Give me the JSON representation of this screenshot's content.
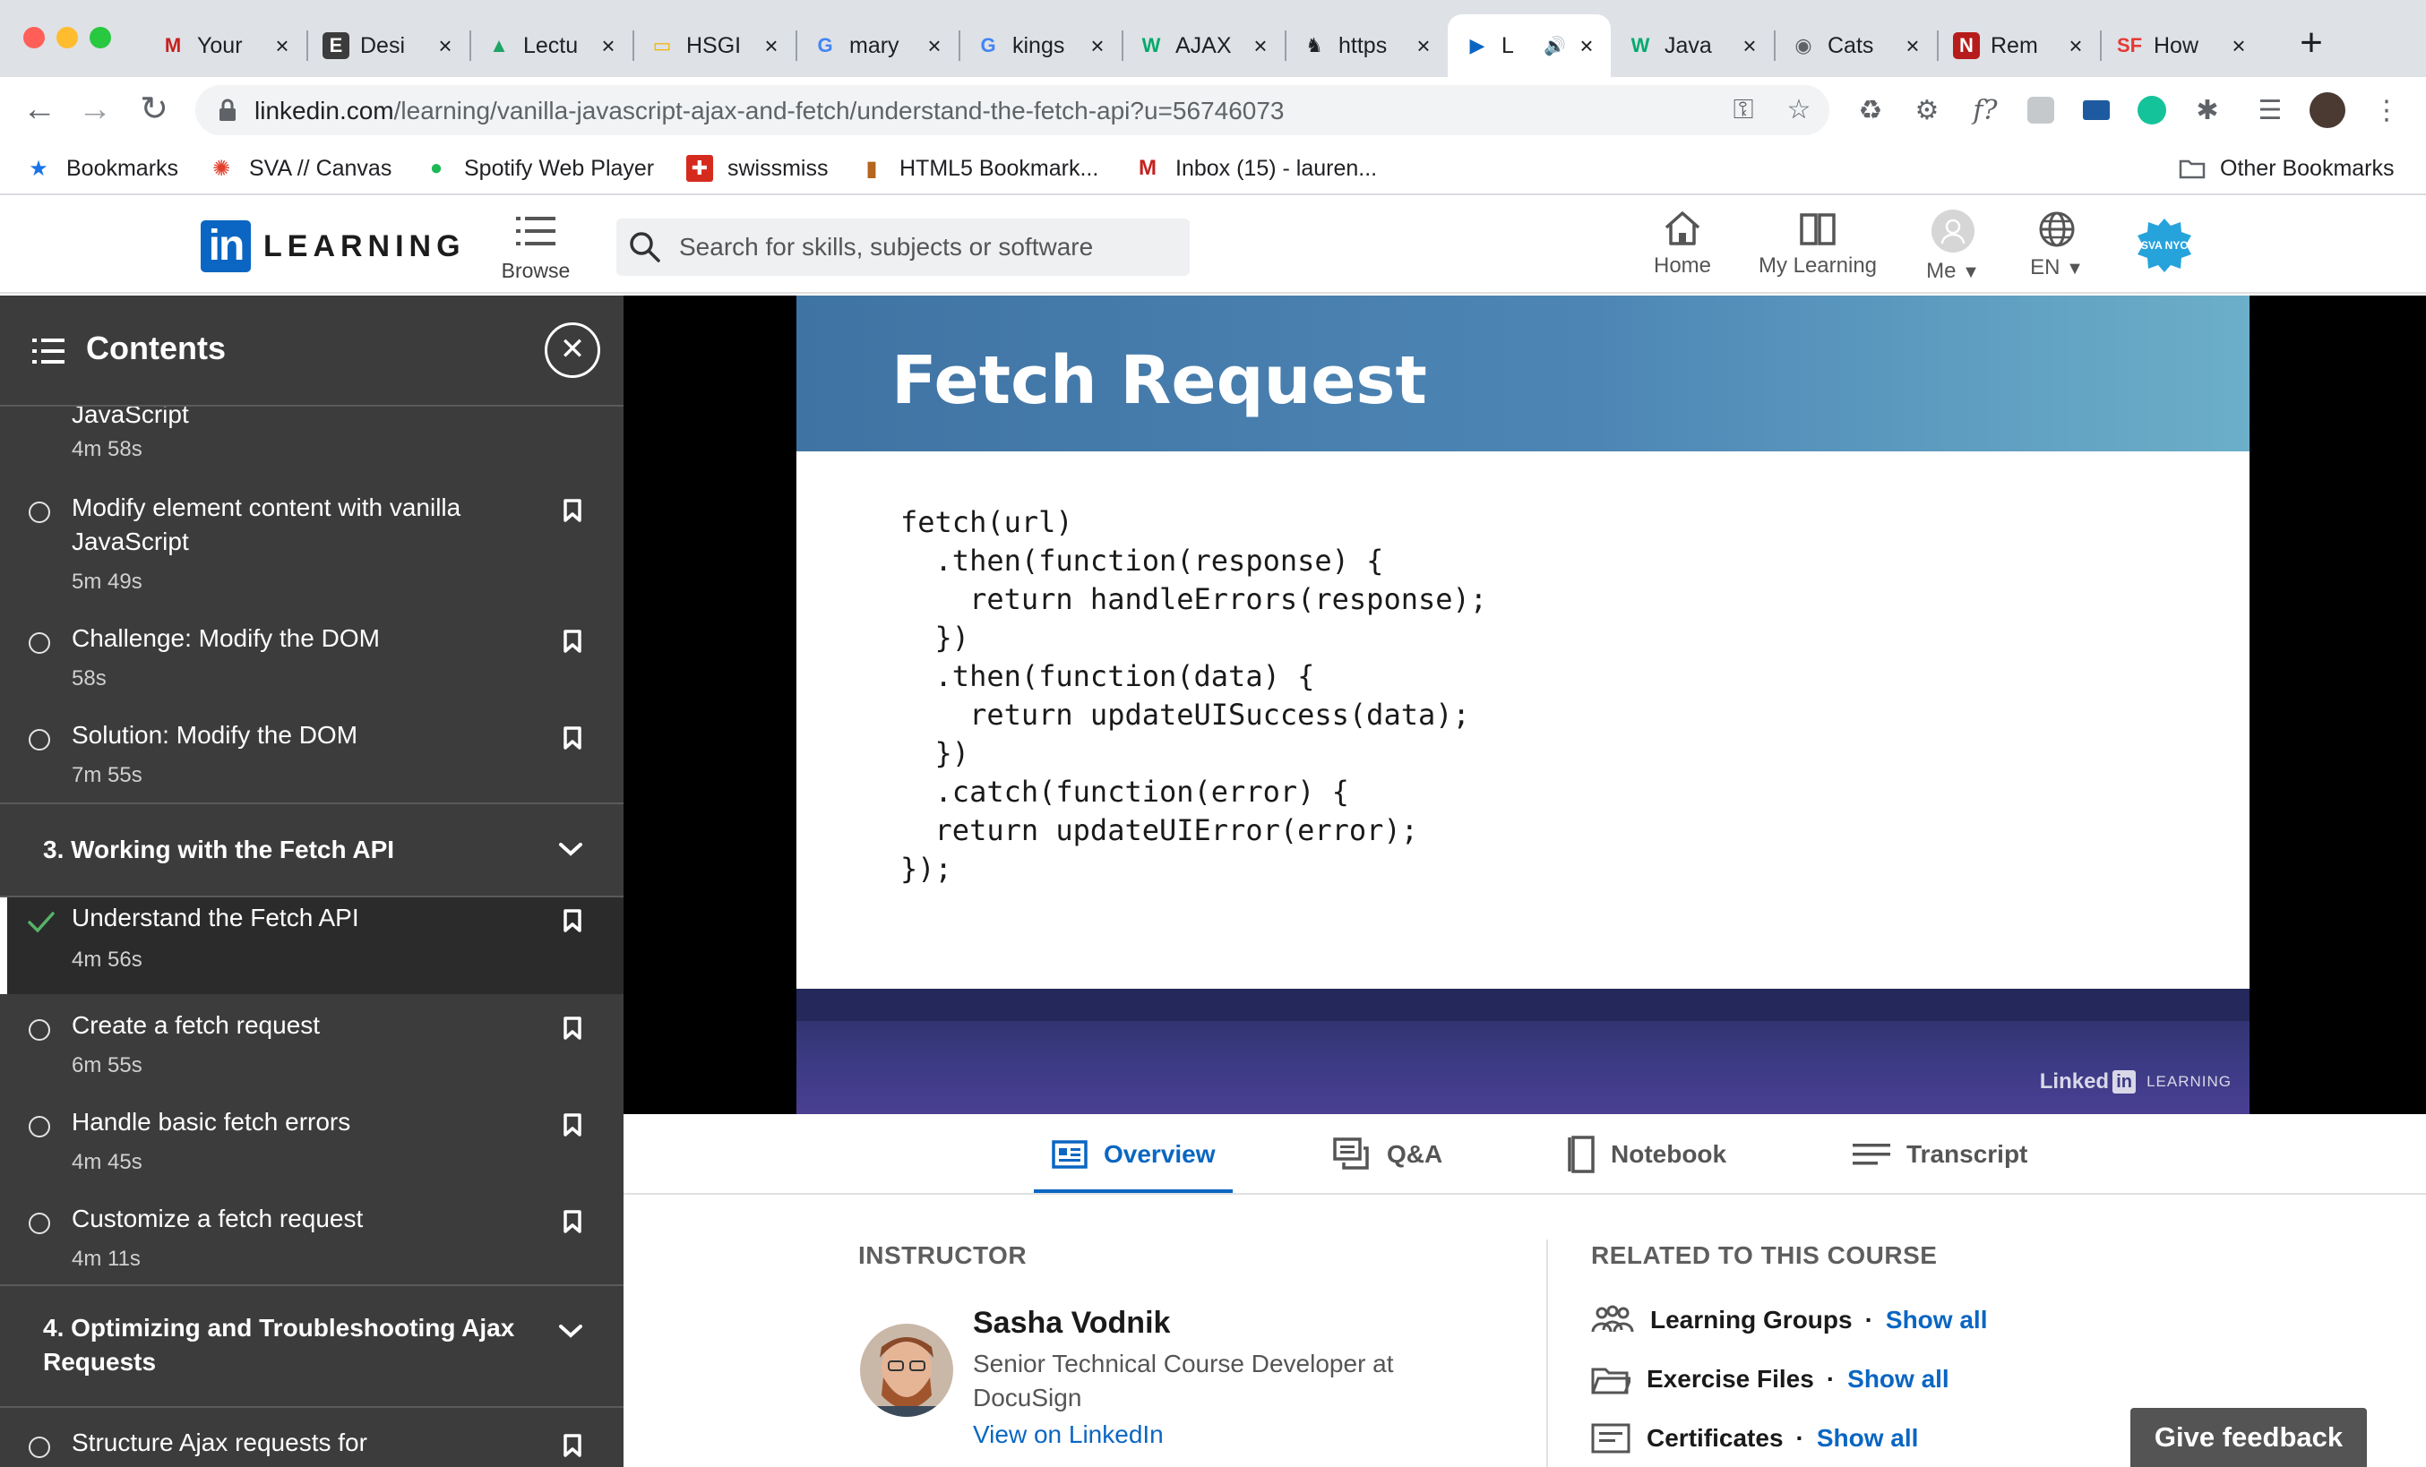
{
  "browser": {
    "tabs": [
      {
        "title": "Your",
        "favicon": "gmail-icon",
        "fav_text": "M",
        "fav_color": "#c5221f",
        "fav_bg": "transparent"
      },
      {
        "title": "Desi",
        "favicon": "e-icon",
        "fav_text": "E",
        "fav_color": "#ffffff",
        "fav_bg": "#3c3c3c"
      },
      {
        "title": "Lectu",
        "favicon": "google-drive-icon",
        "fav_text": "▲",
        "fav_color": "#1fa463",
        "fav_bg": "transparent"
      },
      {
        "title": "HSGI",
        "favicon": "google-slides-icon",
        "fav_text": "▭",
        "fav_color": "#f4b400",
        "fav_bg": "transparent"
      },
      {
        "title": "mary",
        "favicon": "google-icon",
        "fav_text": "G",
        "fav_color": "#4285f4",
        "fav_bg": "transparent"
      },
      {
        "title": "kings",
        "favicon": "google-icon",
        "fav_text": "G",
        "fav_color": "#4285f4",
        "fav_bg": "transparent"
      },
      {
        "title": "AJAX",
        "favicon": "w3schools-icon",
        "fav_text": "W",
        "fav_color": "#04aa6d",
        "fav_bg": "transparent"
      },
      {
        "title": "https",
        "favicon": "unicorn-icon",
        "fav_text": "♞",
        "fav_color": "#202124",
        "fav_bg": "transparent"
      },
      {
        "title": "L",
        "favicon": "linkedin-learning-icon",
        "fav_text": "▶",
        "fav_color": "#0a66c2",
        "fav_bg": "transparent",
        "active": true
      },
      {
        "title": "Java",
        "favicon": "w3schools-icon",
        "fav_text": "W",
        "fav_color": "#04aa6d",
        "fav_bg": "transparent"
      },
      {
        "title": "Cats",
        "favicon": "globe-icon",
        "fav_text": "◉",
        "fav_color": "#5f6368",
        "fav_bg": "transparent"
      },
      {
        "title": "Rem",
        "favicon": "ne-icon",
        "fav_text": "N",
        "fav_color": "#ffffff",
        "fav_bg": "#b71c1c"
      },
      {
        "title": "How",
        "favicon": "sf-icon",
        "fav_text": "SF",
        "fav_color": "#e53935",
        "fav_bg": "transparent"
      }
    ],
    "url_host": "linkedin.com",
    "url_path": "/learning/vanilla-javascript-ajax-and-fetch/understand-the-fetch-api?u=56746073",
    "bookmarks": [
      {
        "label": "Bookmarks",
        "icon": "star-icon",
        "glyph": "★",
        "color": "#1a73e8"
      },
      {
        "label": "SVA // Canvas",
        "icon": "canvas-icon",
        "glyph": "✺",
        "color": "#e13f2b"
      },
      {
        "label": "Spotify Web Player",
        "icon": "spotify-icon",
        "glyph": "●",
        "color": "#1db954"
      },
      {
        "label": "swissmiss",
        "icon": "swiss-icon",
        "glyph": "✚",
        "color": "#d52b1e"
      },
      {
        "label": "HTML5 Bookmark...",
        "icon": "bottle-icon",
        "glyph": "▮",
        "color": "#b5651d"
      },
      {
        "label": "Inbox (15) - lauren...",
        "icon": "gmail-icon",
        "glyph": "M",
        "color": "#c5221f"
      }
    ],
    "other_bookmarks": "Other Bookmarks"
  },
  "header": {
    "logo_in": "in",
    "logo_word": "LEARNING",
    "browse": "Browse",
    "search_placeholder": "Search for skills, subjects or software",
    "nav": {
      "home": "Home",
      "my_learning": "My Learning",
      "me": "Me",
      "lang": "EN"
    },
    "org_badge": "SVA NYC"
  },
  "sidebar": {
    "title": "Contents",
    "items": [
      {
        "title": "JavaScript",
        "duration": "4m 58s"
      },
      {
        "title": "Modify element content with vanilla JavaScript",
        "duration": "5m 49s"
      },
      {
        "title": "Challenge: Modify the DOM",
        "duration": "58s"
      },
      {
        "title": "Solution: Modify the DOM",
        "duration": "7m 55s"
      }
    ],
    "section3": "3. Working with the Fetch API",
    "active_item": {
      "title": "Understand the Fetch API",
      "duration": "4m 56s"
    },
    "items2": [
      {
        "title": "Create a fetch request",
        "duration": "6m 55s"
      },
      {
        "title": "Handle basic fetch errors",
        "duration": "4m 45s"
      },
      {
        "title": "Customize a fetch request",
        "duration": "4m 11s"
      }
    ],
    "section4": "4. Optimizing and Troubleshooting Ajax Requests",
    "last_item": "Structure Ajax requests for"
  },
  "video": {
    "slide_title": "Fetch Request",
    "code": "fetch(url)\n  .then(function(response) {\n    return handleErrors(response);\n  })\n  .then(function(data) {\n    return updateUISuccess(data);\n  })\n  .catch(function(error) {\n  return updateUIError(error);\n});",
    "watermark_brand": "Linked",
    "watermark_in": "in",
    "watermark_word": "LEARNING"
  },
  "content_tabs": {
    "overview": "Overview",
    "qa": "Q&A",
    "notebook": "Notebook",
    "transcript": "Transcript"
  },
  "instructor": {
    "heading": "INSTRUCTOR",
    "name": "Sasha Vodnik",
    "role": "Senior Technical Course Developer at DocuSign",
    "link": "View on LinkedIn"
  },
  "related": {
    "heading": "RELATED TO THIS COURSE",
    "items": [
      {
        "name": "Learning Groups",
        "action": "Show all"
      },
      {
        "name": "Exercise Files",
        "action": "Show all"
      },
      {
        "name": "Certificates",
        "action": "Show all"
      }
    ],
    "separator": "·"
  },
  "feedback": "Give feedback",
  "colors": {
    "accent": "#0a66c2",
    "sidebar_bg": "#3c3c3c",
    "complete_check": "#57b26a"
  }
}
